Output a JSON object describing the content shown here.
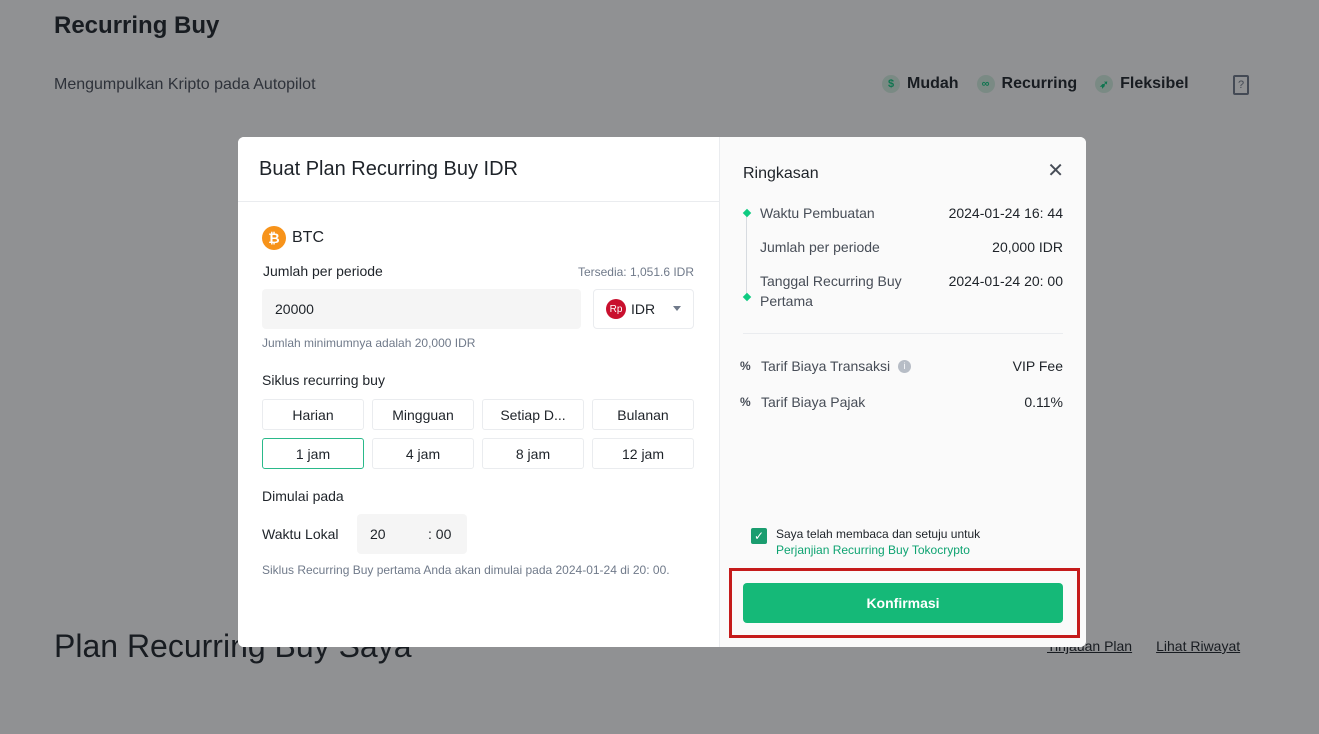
{
  "page": {
    "title": "Recurring Buy",
    "subtitle": "Mengumpulkan Kripto pada Autopilot",
    "features": [
      {
        "label": "Mudah",
        "icon": "clock-dollar-icon"
      },
      {
        "label": "Recurring",
        "icon": "link-icon"
      },
      {
        "label": "Fleksibel",
        "icon": "rocket-icon"
      }
    ],
    "plans_title": "Plan Recurring Buy Saya",
    "links": {
      "overview": "Tinjauan Plan",
      "history": "Lihat Riwayat"
    }
  },
  "modal": {
    "title": "Buat Plan Recurring Buy IDR",
    "coin": {
      "symbol": "BTC",
      "icon": "bitcoin-icon",
      "color": "#f7931a"
    },
    "amount": {
      "label": "Jumlah per periode",
      "available": "Tersedia: 1,051.6 IDR",
      "value": "20000",
      "currency": "IDR",
      "currency_icon": "Rp",
      "min_note": "Jumlah minimumnya adalah 20,000 IDR"
    },
    "cycle": {
      "label": "Siklus recurring buy",
      "periods": [
        "Harian",
        "Mingguan",
        "Setiap D...",
        "Bulanan"
      ],
      "hours": [
        "1 jam",
        "4 jam",
        "8 jam",
        "12 jam"
      ],
      "selected_hour": "1 jam"
    },
    "start": {
      "label": "Dimulai pada",
      "local_label": "Waktu Lokal",
      "hour": "20",
      "minute": ": 00",
      "note": "Siklus Recurring Buy pertama Anda akan dimulai pada 2024-01-24 di 20: 00."
    }
  },
  "summary": {
    "title": "Ringkasan",
    "rows": [
      {
        "key": "Waktu Pembuatan",
        "value": "2024-01-24 16: 44"
      },
      {
        "key": "Jumlah per periode",
        "value": "20,000 IDR"
      },
      {
        "key": "Tanggal Recurring Buy Pertama",
        "value": "2024-01-24 20: 00"
      }
    ],
    "fees": [
      {
        "key": "Tarif Biaya Transaksi",
        "value": "VIP Fee"
      },
      {
        "key": "Tarif Biaya Pajak",
        "value": "0.11%"
      }
    ],
    "agreement_text": "Saya telah membaca dan setuju untuk",
    "agreement_link": "Perjanjian Recurring Buy Tokocrypto",
    "agreement_checked": true,
    "confirm_label": "Konfirmasi"
  },
  "colors": {
    "accent": "#15b978",
    "highlight": "#c51b1b",
    "overlay": "rgba(20,21,26,0.47)"
  }
}
